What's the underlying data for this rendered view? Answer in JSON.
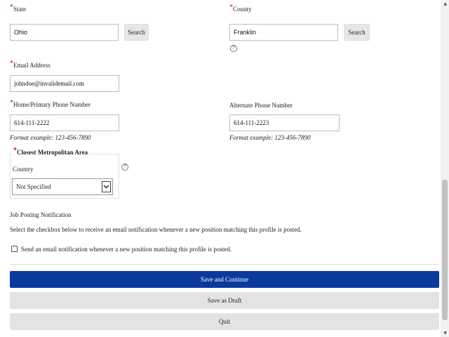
{
  "state": {
    "label": "State",
    "value": "Ohio",
    "search_label": "Search"
  },
  "county": {
    "label": "County",
    "value": "Franklin",
    "search_label": "Search"
  },
  "help_glyph": "?",
  "email": {
    "label": "Email Address",
    "value": "johndoe@invalidemail.com"
  },
  "home_phone": {
    "label": "Home/Primary Phone Number",
    "value": "614-111-2222",
    "hint": "Format example:  123-456-7890"
  },
  "alt_phone": {
    "label": "Alternate Phone Number",
    "value": "614-111-2223",
    "hint": "Format example:  123-456-7890"
  },
  "metro": {
    "legend": "Closest Metropolitan Area",
    "country_label": "Country",
    "country_value": "Not Specified"
  },
  "notification": {
    "heading": "Job Posting Notification",
    "description": "Select the checkbox below to receive an email notification whenever a new position matching this profile is posted.",
    "checkbox_label": "Send an email notification whenever a new position matching this profile is posted."
  },
  "actions": {
    "save_continue": "Save and Continue",
    "save_draft": "Save as Draft",
    "quit": "Quit"
  },
  "required_mark": "*",
  "colors": {
    "primary": "#0a3a9e",
    "required": "#d0021b"
  }
}
